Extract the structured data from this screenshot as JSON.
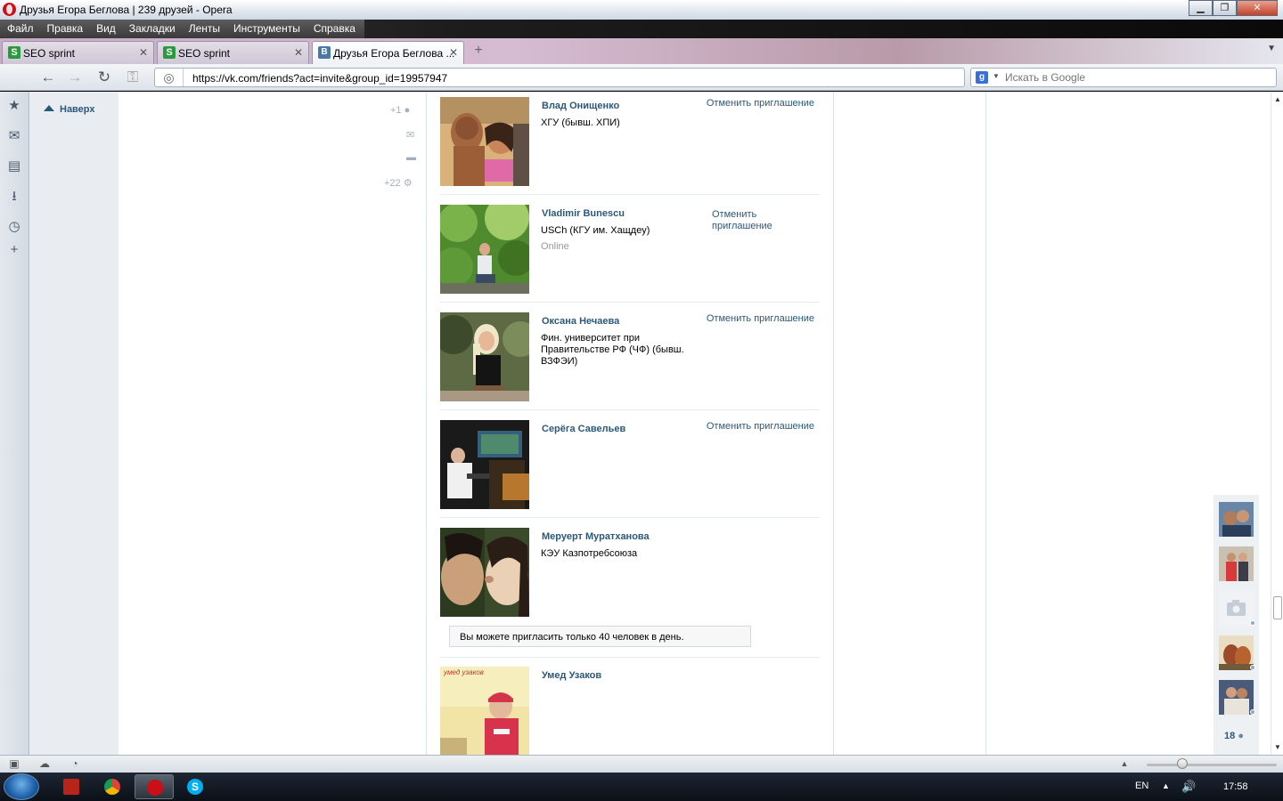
{
  "window": {
    "title": "Друзья Егора Беглова | 239 друзей - Opera",
    "controls": {
      "minimize": "▁",
      "restore": "❐",
      "close": "✕"
    }
  },
  "menu": [
    "Файл",
    "Правка",
    "Вид",
    "Закладки",
    "Ленты",
    "Инструменты",
    "Справка"
  ],
  "tabs": [
    {
      "label": "SEO sprint",
      "icon": "seo-sprint-icon",
      "close": "✕"
    },
    {
      "label": "SEO sprint",
      "icon": "seo-sprint-icon",
      "close": "✕"
    },
    {
      "label": "Друзья Егора Беглова ...",
      "icon": "vk-icon",
      "close": "✕",
      "icon_letter": "В"
    }
  ],
  "tabbar": {
    "new_tab": "+",
    "menu": "▼"
  },
  "address": {
    "url": "https://vk.com/friends?act=invite&group_id=19957947",
    "search_placeholder": "Искать в Google",
    "search_engine_letter": "g"
  },
  "page": {
    "to_top": "Наверх",
    "left_counts": {
      "friends_plus": "+1",
      "settings_plus": "+22"
    },
    "friends": [
      {
        "name": "Влад Онищенко",
        "sub": "ХГУ (бывш. ХПИ)",
        "status": "",
        "action": "Отменить приглашение"
      },
      {
        "name": "Vladimir Bunescu",
        "sub": "USCh (КГУ им. Хащдеу)",
        "status": "Online",
        "action": "Отменить приглашение"
      },
      {
        "name": "Оксана Нечаева",
        "sub": "Фин. университет при Правительстве РФ (ЧФ) (бывш. ВЗФЭИ)",
        "status": "",
        "action": "Отменить приглашение"
      },
      {
        "name": "Серёга Савельев",
        "sub": "",
        "status": "",
        "action": "Отменить приглашение"
      },
      {
        "name": "Меруерт Муратханова",
        "sub": "КЭУ Казпотребсоюза",
        "status": "",
        "action": ""
      },
      {
        "name": "Умед Узаков",
        "sub": "",
        "status": "",
        "action": ""
      }
    ],
    "notice": "Вы можете пригласить только 40 человек в день.",
    "photo5_caption": "умед узаков",
    "right_bar_count": "18"
  },
  "taskbar": {
    "language": "EN",
    "time": "17:58"
  },
  "colors": {
    "vk_link": "#2b587a",
    "vk_blue": "#4a76a8",
    "opera_red": "#cc0f16"
  }
}
